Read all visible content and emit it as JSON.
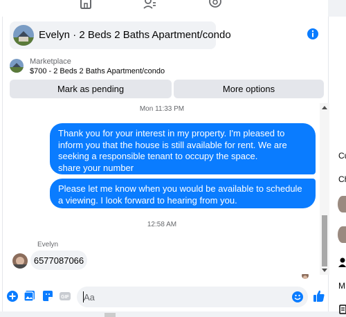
{
  "header": {
    "title": "Evelyn · 2 Beds 2 Baths Apartment/condo"
  },
  "marketplace": {
    "label": "Marketplace",
    "listing": "$700 - 2 Beds 2 Baths Apartment/condo"
  },
  "actions": {
    "pending_label": "Mark as pending",
    "more_label": "More options"
  },
  "messages": {
    "time1": "Mon 11:33 PM",
    "out1": "Thank you for your interest in my property. I'm pleased to inform you that the house is still available for rent. We are seeking a responsible tenant to occupy the space.\nshare your number",
    "out2": "Please let me know when you would be available to schedule a viewing. I look forward to hearing from you.",
    "time2": "12:58 AM",
    "sender": "Evelyn",
    "in1": "6577087066"
  },
  "composer": {
    "placeholder": "Aa"
  },
  "side_panel": {
    "item1": "Cu",
    "item2": "Ch",
    "item3": "M"
  },
  "colors": {
    "accent": "#0a7cff",
    "bubble_in": "#f0f2f5"
  }
}
